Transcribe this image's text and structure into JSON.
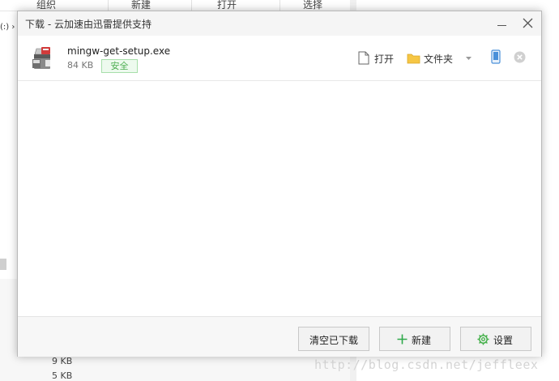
{
  "background_window": {
    "ribbon": [
      "组织",
      "新建",
      "打开",
      "选择"
    ],
    "left_fragment": "(:) ›",
    "sizes": [
      "9 KB",
      "5 KB"
    ],
    "watermark": "http://blog.csdn.net/jeffleex"
  },
  "dialog": {
    "title": "下载 - 云加速由迅雷提供支持",
    "download": {
      "file_name": "mingw-get-setup.exe",
      "file_size": "84 KB",
      "badge": "安全",
      "open_label": "打开",
      "folder_label": "文件夹"
    },
    "footer": {
      "clear_label": "清空已下载",
      "new_label": "新建",
      "settings_label": "设置"
    }
  },
  "colors": {
    "safe_green": "#4cad50",
    "new_plus": "#2ea84a",
    "settings_gear": "#44b04a",
    "folder_yellow": "#f6c644",
    "phone_blue": "#4a90d9"
  }
}
